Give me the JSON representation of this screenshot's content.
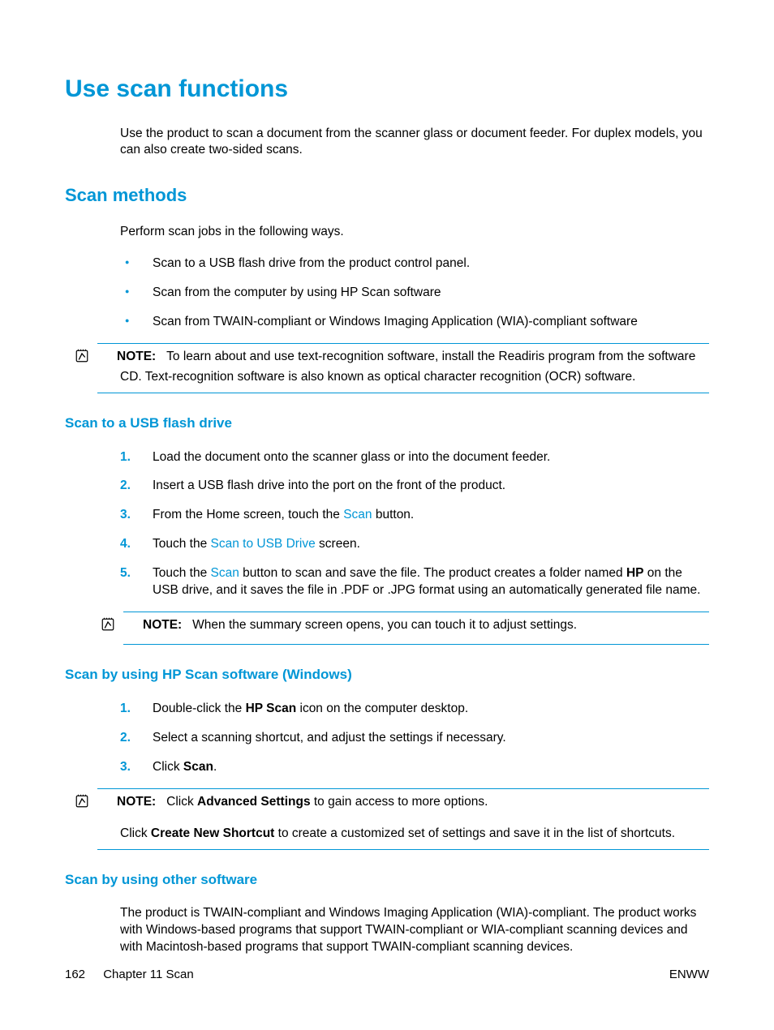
{
  "title": "Use scan functions",
  "intro": "Use the product to scan a document from the scanner glass or document feeder. For duplex models, you can also create two-sided scans.",
  "section1": {
    "heading": "Scan methods",
    "lead": "Perform scan jobs in the following ways.",
    "bullets": [
      "Scan to a USB flash drive from the product control panel.",
      "Scan from the computer by using HP Scan software",
      "Scan from TWAIN-compliant or Windows Imaging Application (WIA)-compliant software"
    ],
    "note_label": "NOTE:",
    "note_text": "To learn about and use text-recognition software, install the Readiris program from the software CD. Text-recognition software is also known as optical character recognition (OCR) software."
  },
  "section2": {
    "heading": "Scan to a USB flash drive",
    "steps": {
      "s1": "Load the document onto the scanner glass or into the document feeder.",
      "s2": "Insert a USB flash drive into the port on the front of the product.",
      "s3_pre": "From the Home screen, touch the ",
      "s3_link": "Scan",
      "s3_post": " button.",
      "s4_pre": "Touch the ",
      "s4_link": "Scan to USB Drive",
      "s4_post": " screen.",
      "s5_pre": "Touch the ",
      "s5_link": "Scan",
      "s5_mid": " button to scan and save the file. The product creates a folder named ",
      "s5_bold": "HP",
      "s5_post": " on the USB drive, and it saves the file in .PDF or .JPG format using an automatically generated file name."
    },
    "note_label": "NOTE:",
    "note_text": "When the summary screen opens, you can touch it to adjust settings."
  },
  "section3": {
    "heading": "Scan by using HP Scan software (Windows)",
    "steps": {
      "s1_pre": "Double-click the ",
      "s1_bold": "HP Scan",
      "s1_post": " icon on the computer desktop.",
      "s2": "Select a scanning shortcut, and adjust the settings if necessary.",
      "s3_pre": "Click ",
      "s3_bold": "Scan",
      "s3_post": "."
    },
    "note_label": "NOTE:",
    "note1_pre": "Click ",
    "note1_bold": "Advanced Settings",
    "note1_post": " to gain access to more options.",
    "note2_pre": "Click ",
    "note2_bold": "Create New Shortcut",
    "note2_post": " to create a customized set of settings and save it in the list of shortcuts."
  },
  "section4": {
    "heading": "Scan by using other software",
    "body": "The product is TWAIN-compliant and Windows Imaging Application (WIA)-compliant. The product works with Windows-based programs that support TWAIN-compliant or WIA-compliant scanning devices and with Macintosh-based programs that support TWAIN-compliant scanning devices."
  },
  "footer": {
    "page": "162",
    "chapter": "Chapter 11   Scan",
    "right": "ENWW"
  }
}
